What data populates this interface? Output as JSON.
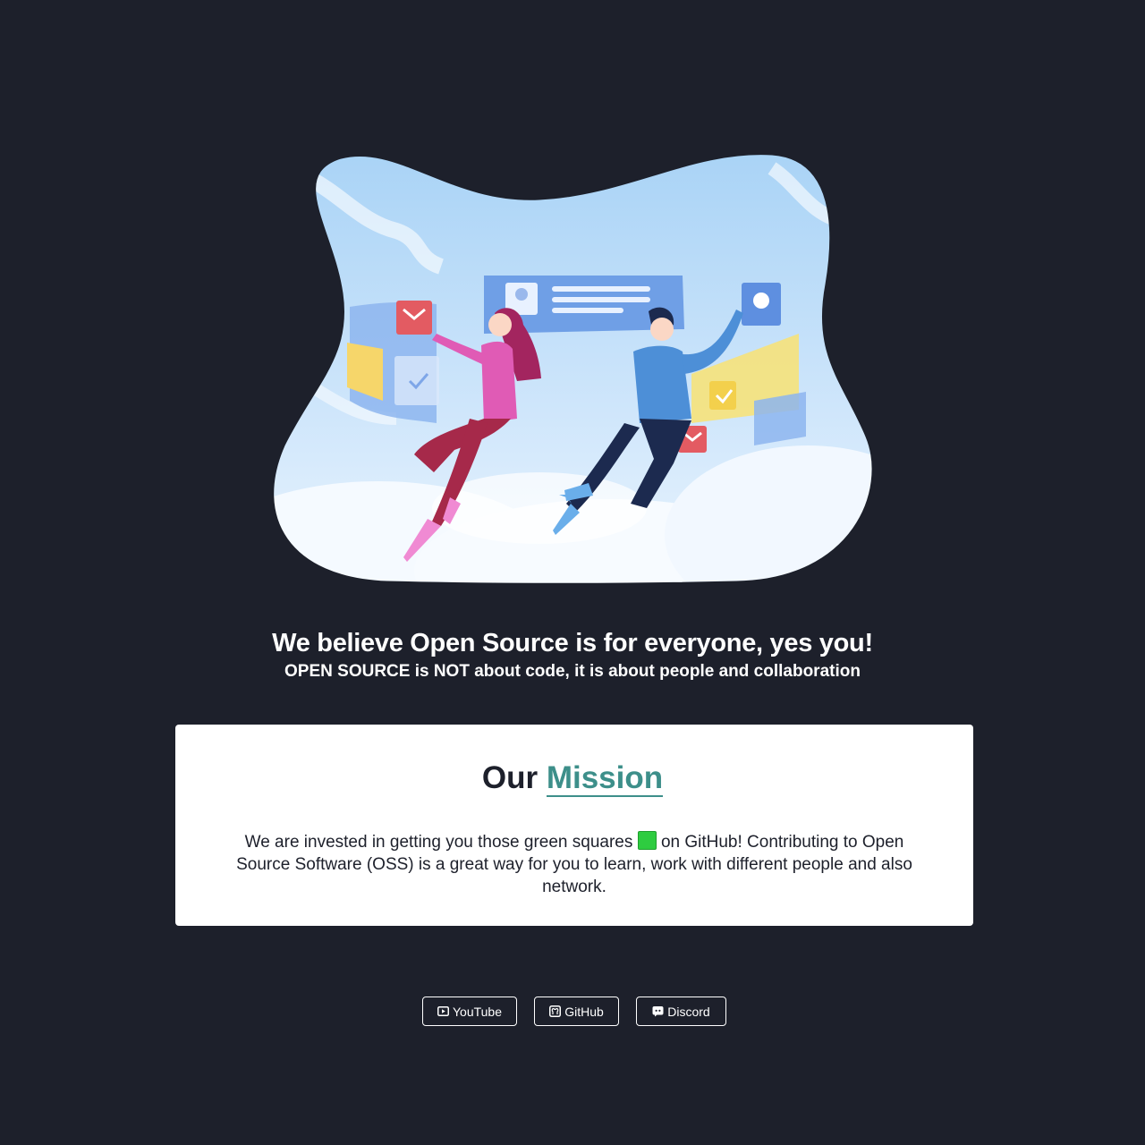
{
  "hero": {
    "illustration_icon": "people-collaborating-illustration"
  },
  "headline": "We believe Open Source is for everyone, yes you!",
  "subheadline": "OPEN SOURCE is NOT about code, it is about people and collaboration",
  "mission": {
    "title_prefix": "Our",
    "title_accent": "Mission",
    "text_before": "We are invested in getting you those green squares",
    "green_square_icon": "green-square-emoji",
    "text_after": "on GitHub! Contributing to Open Source Software (OSS) is a great way for you to learn, work with different people and also network."
  },
  "links": [
    {
      "label": "YouTube",
      "icon": "youtube-icon"
    },
    {
      "label": "GitHub",
      "icon": "github-icon"
    },
    {
      "label": "Discord",
      "icon": "discord-icon"
    }
  ],
  "colors": {
    "background": "#1d202b",
    "accent": "#3d8f8a",
    "card": "#ffffff",
    "green_square": "#2ecc40"
  }
}
